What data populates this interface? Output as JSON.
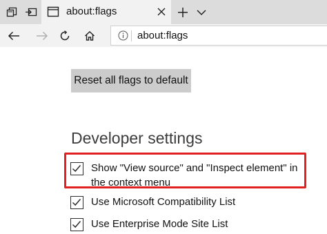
{
  "tabbar": {
    "tab_title": "about:flags",
    "icons": [
      "tab-list-icon",
      "set-aside-tabs-icon",
      "page-icon",
      "close-icon",
      "new-tab-plus-icon",
      "chevron-down-icon"
    ]
  },
  "navbar": {
    "address": "about:flags",
    "icons": [
      "back-arrow-icon",
      "forward-arrow-icon",
      "refresh-icon",
      "home-icon",
      "info-icon"
    ]
  },
  "content": {
    "reset_button_label": "Reset all flags to default",
    "section_title": "Developer settings",
    "flags": [
      {
        "label": "Show \"View source\" and \"Inspect element\" in the context menu",
        "checked": true,
        "highlighted": true
      },
      {
        "label": "Use Microsoft Compatibility List",
        "checked": true,
        "highlighted": false
      },
      {
        "label": "Use Enterprise Mode Site List",
        "checked": true,
        "highlighted": false
      }
    ],
    "highlight_color": "#e02121"
  },
  "colors": {
    "tabbar_bg": "#dcdcdc",
    "active_tab_bg": "#f2f2f2",
    "button_bg": "#cccccc"
  }
}
